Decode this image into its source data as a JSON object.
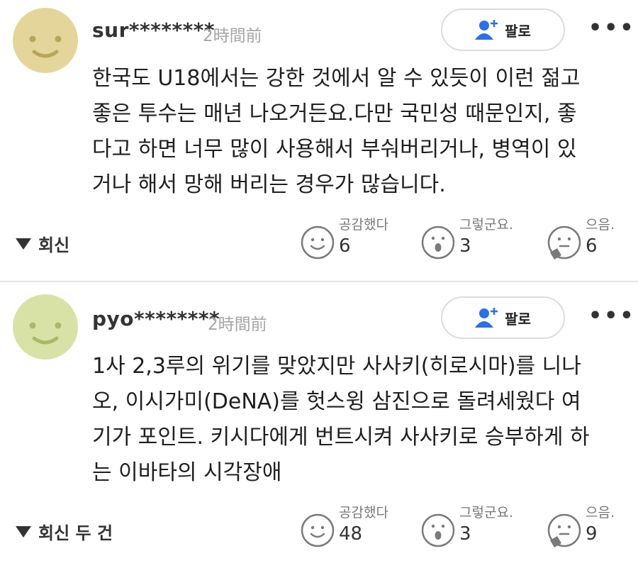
{
  "comments": [
    {
      "username": "sur********",
      "time": "2時間前",
      "follow_label": "팔로",
      "more_label": "•••",
      "lines": [
        "한국도 U18에서는 강한 것에서 알 수 있듯이 이런 젊고",
        "좋은 투수는 매년 나오거든요.다만 국민성 때문인지, 좋",
        "다고 하면 너무 많이 사용해서 부숴버리거나, 병역이 있",
        "거나 해서 망해 버리는 경우가 많습니다."
      ],
      "reply_label": "회신",
      "reactions": [
        {
          "label": "공감했다",
          "count": "6",
          "icon": "smile-face-icon"
        },
        {
          "label": "그렇군요.",
          "count": "3",
          "icon": "surprised-face-icon"
        },
        {
          "label": "으음.",
          "count": "6",
          "icon": "thinking-face-icon"
        }
      ],
      "avatar_color": "#e4d69a"
    },
    {
      "username": "pyo********",
      "time": "2時間前",
      "follow_label": "팔로",
      "more_label": "•••",
      "lines": [
        "1사 2,3루의 위기를 맞았지만 사사키(히로시마)를 니나",
        "오, 이시가미(DeNA)를 헛스윙 삼진으로 돌려세웠다 여",
        "기가 포인트. 키시다에게 번트시켜 사사키로 승부하게 하",
        "는 이바타의 시각장애"
      ],
      "reply_label": "회신 두 건",
      "reactions": [
        {
          "label": "공감했다",
          "count": "48",
          "icon": "smile-face-icon"
        },
        {
          "label": "그렇군요.",
          "count": "3",
          "icon": "surprised-face-icon"
        },
        {
          "label": "으음.",
          "count": "9",
          "icon": "thinking-face-icon"
        }
      ],
      "avatar_color": "#d8e2a6"
    }
  ],
  "colors": {
    "follow_icon": "#2f6fe0",
    "reaction_icon": "#7a7a7a",
    "divider": "#e6e6e6"
  }
}
